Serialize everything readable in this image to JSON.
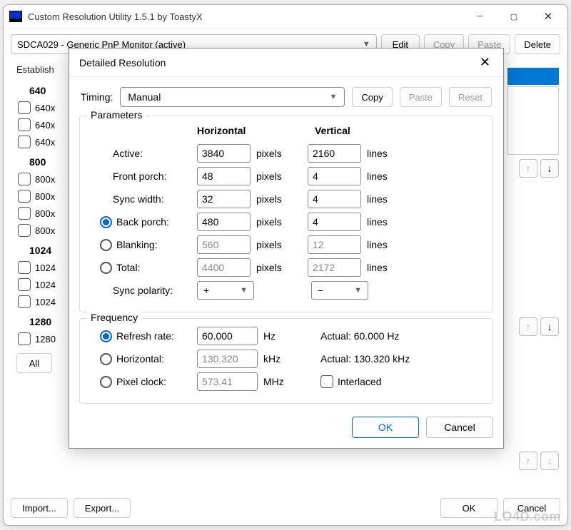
{
  "window": {
    "title": "Custom Resolution Utility 1.5.1 by ToastyX",
    "monitor": "SDCA029 - Generic PnP Monitor (active)",
    "buttons": {
      "edit": "Edit",
      "copy": "Copy",
      "paste": "Paste",
      "delete": "Delete"
    },
    "establish_label": "Establish",
    "groups": {
      "g640": "640",
      "g640_items": [
        "640x",
        "640x",
        "640x"
      ],
      "g800": "800",
      "g800_items": [
        "800x",
        "800x",
        "800x",
        "800x"
      ],
      "g1024": "1024",
      "g1024_items": [
        "1024",
        "1024",
        "1024"
      ],
      "g1280": "1280",
      "g1280_items": [
        "1280"
      ]
    },
    "all_btn": "All",
    "import_btn": "Import...",
    "export_btn": "Export...",
    "ok_btn": "OK",
    "cancel_btn": "Cancel"
  },
  "dialog": {
    "title": "Detailed Resolution",
    "timing_label": "Timing:",
    "timing_value": "Manual",
    "copy": "Copy",
    "paste": "Paste",
    "reset": "Reset",
    "parameters_label": "Parameters",
    "col_h": "Horizontal",
    "col_v": "Vertical",
    "rows": {
      "active": {
        "label": "Active:",
        "h": "3840",
        "hu": "pixels",
        "v": "2160",
        "vu": "lines"
      },
      "front_porch": {
        "label": "Front porch:",
        "h": "48",
        "hu": "pixels",
        "v": "4",
        "vu": "lines"
      },
      "sync_width": {
        "label": "Sync width:",
        "h": "32",
        "hu": "pixels",
        "v": "4",
        "vu": "lines"
      },
      "back_porch": {
        "label": "Back porch:",
        "h": "480",
        "hu": "pixels",
        "v": "4",
        "vu": "lines"
      },
      "blanking": {
        "label": "Blanking:",
        "h": "560",
        "hu": "pixels",
        "v": "12",
        "vu": "lines"
      },
      "total": {
        "label": "Total:",
        "h": "4400",
        "hu": "pixels",
        "v": "2172",
        "vu": "lines"
      }
    },
    "sync_polarity_label": "Sync polarity:",
    "sync_polarity_h": "+",
    "sync_polarity_v": "−",
    "frequency_label": "Frequency",
    "freq": {
      "refresh": {
        "label": "Refresh rate:",
        "val": "60.000",
        "unit": "Hz",
        "actual": "Actual: 60.000 Hz"
      },
      "horizontal": {
        "label": "Horizontal:",
        "val": "130.320",
        "unit": "kHz",
        "actual": "Actual: 130.320 kHz"
      },
      "pixel": {
        "label": "Pixel clock:",
        "val": "573.41",
        "unit": "MHz"
      }
    },
    "interlaced_label": "Interlaced",
    "ok": "OK",
    "cancel": "Cancel"
  },
  "watermark": "LO4D.com"
}
